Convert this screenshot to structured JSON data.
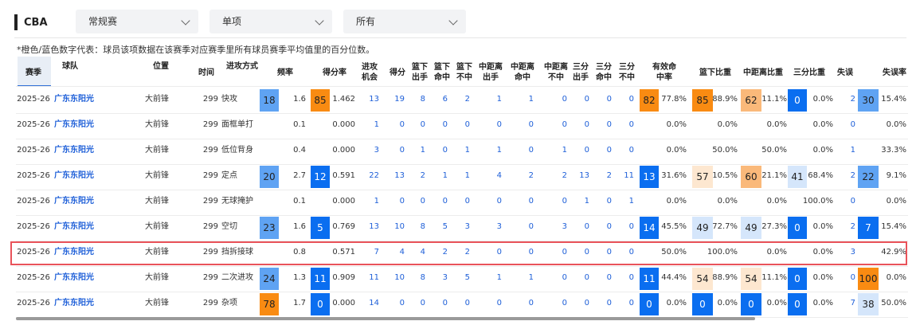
{
  "league": "CBA",
  "filters": [
    {
      "value": "常规赛"
    },
    {
      "value": "单项"
    },
    {
      "value": "所有"
    }
  ],
  "note": "*橙色/蓝色数字代表：球员该项数据在该赛季对应赛季里所有球员赛季平均值里的百分位数。",
  "columns": [
    "赛季",
    "球队",
    "位置",
    "时间",
    "进攻方式",
    "频率",
    "得分率",
    "进攻机会",
    "得分",
    "篮下出手",
    "篮下命中",
    "篮下不中",
    "中距离出手",
    "中距离命中",
    "中距离不中",
    "三分出手",
    "三分命中",
    "三分不中",
    "有效命中率",
    "篮下比重",
    "中距离比重",
    "三分比重",
    "失误",
    "失误率"
  ],
  "colors": {
    "orange_strong": "#f98b12",
    "orange_mid": "#fab97a",
    "orange_light": "#fde7d0",
    "blue_strong": "#0a6ef0",
    "blue_mid": "#5fa3f3",
    "blue_light": "#d5e6fb",
    "highlight": "#e9535a",
    "link": "#1e5fd8"
  },
  "rows": [
    {
      "season": "2025-26",
      "team": "广东东阳光",
      "pos": "大前锋",
      "time": "299",
      "play": "快攻",
      "freq_pct": "18",
      "freq": "1.6",
      "ppp_pct": "85",
      "ppp": "1.462",
      "poss": "13",
      "pts": "19",
      "rim_att": "8",
      "rim_made": "6",
      "rim_miss": "2",
      "mid_att": "1",
      "mid_made": "1",
      "mid_miss": "0",
      "three_att": "0",
      "three_made": "0",
      "three_miss": "0",
      "efg_pct": "82",
      "efg": "77.8%",
      "rim_share_pct": "85",
      "rim_share": "88.9%",
      "mid_share_pct": "62",
      "mid_share": "11.1%",
      "three_share_pct": "0",
      "three_share": "0.0%",
      "tov": "2",
      "tov_pct": "30",
      "tov_rate": "15.4%"
    },
    {
      "season": "2025-26",
      "team": "广东东阳光",
      "pos": "大前锋",
      "time": "299",
      "play": "面框单打",
      "freq_pct": "",
      "freq": "0.1",
      "ppp_pct": "",
      "ppp": "0.000",
      "poss": "1",
      "pts": "0",
      "rim_att": "0",
      "rim_made": "0",
      "rim_miss": "0",
      "mid_att": "0",
      "mid_made": "0",
      "mid_miss": "0",
      "three_att": "0",
      "three_made": "0",
      "three_miss": "0",
      "efg_pct": "",
      "efg": "0.0%",
      "rim_share_pct": "",
      "rim_share": "0.0%",
      "mid_share_pct": "",
      "mid_share": "0.0%",
      "three_share_pct": "",
      "three_share": "0.0%",
      "tov": "0",
      "tov_pct": "",
      "tov_rate": "0.0%"
    },
    {
      "season": "2025-26",
      "team": "广东东阳光",
      "pos": "大前锋",
      "time": "299",
      "play": "低位背身",
      "freq_pct": "",
      "freq": "0.4",
      "ppp_pct": "",
      "ppp": "0.000",
      "poss": "3",
      "pts": "0",
      "rim_att": "1",
      "rim_made": "0",
      "rim_miss": "1",
      "mid_att": "1",
      "mid_made": "0",
      "mid_miss": "1",
      "three_att": "0",
      "three_made": "0",
      "three_miss": "0",
      "efg_pct": "",
      "efg": "0.0%",
      "rim_share_pct": "",
      "rim_share": "50.0%",
      "mid_share_pct": "",
      "mid_share": "50.0%",
      "three_share_pct": "",
      "three_share": "0.0%",
      "tov": "1",
      "tov_pct": "",
      "tov_rate": "33.3%"
    },
    {
      "season": "2025-26",
      "team": "广东东阳光",
      "pos": "大前锋",
      "time": "299",
      "play": "定点",
      "freq_pct": "20",
      "freq": "2.7",
      "ppp_pct": "12",
      "ppp": "0.591",
      "poss": "22",
      "pts": "13",
      "rim_att": "2",
      "rim_made": "1",
      "rim_miss": "1",
      "mid_att": "4",
      "mid_made": "2",
      "mid_miss": "2",
      "three_att": "13",
      "three_made": "2",
      "three_miss": "11",
      "efg_pct": "13",
      "efg": "31.6%",
      "rim_share_pct": "57",
      "rim_share": "10.5%",
      "mid_share_pct": "60",
      "mid_share": "21.1%",
      "three_share_pct": "41",
      "three_share": "68.4%",
      "tov": "2",
      "tov_pct": "22",
      "tov_rate": "9.1%"
    },
    {
      "season": "2025-26",
      "team": "广东东阳光",
      "pos": "大前锋",
      "time": "299",
      "play": "无球掩护",
      "freq_pct": "",
      "freq": "0.1",
      "ppp_pct": "",
      "ppp": "0.000",
      "poss": "1",
      "pts": "0",
      "rim_att": "0",
      "rim_made": "0",
      "rim_miss": "0",
      "mid_att": "0",
      "mid_made": "0",
      "mid_miss": "0",
      "three_att": "1",
      "three_made": "0",
      "three_miss": "1",
      "efg_pct": "",
      "efg": "0.0%",
      "rim_share_pct": "",
      "rim_share": "0.0%",
      "mid_share_pct": "",
      "mid_share": "0.0%",
      "three_share_pct": "",
      "three_share": "100.0%",
      "tov": "0",
      "tov_pct": "",
      "tov_rate": "0.0%"
    },
    {
      "season": "2025-26",
      "team": "广东东阳光",
      "pos": "大前锋",
      "time": "299",
      "play": "空切",
      "freq_pct": "23",
      "freq": "1.6",
      "ppp_pct": "5",
      "ppp": "0.769",
      "poss": "13",
      "pts": "10",
      "rim_att": "8",
      "rim_made": "5",
      "rim_miss": "3",
      "mid_att": "3",
      "mid_made": "0",
      "mid_miss": "3",
      "three_att": "0",
      "three_made": "0",
      "three_miss": "0",
      "efg_pct": "14",
      "efg": "45.5%",
      "rim_share_pct": "49",
      "rim_share": "72.7%",
      "mid_share_pct": "49",
      "mid_share": "27.3%",
      "three_share_pct": "0",
      "three_share": "0.0%",
      "tov": "2",
      "tov_pct": "7",
      "tov_rate": "15.4%"
    },
    {
      "season": "2025-26",
      "team": "广东东阳光",
      "pos": "大前锋",
      "time": "299",
      "play": "挡拆接球",
      "freq_pct": "",
      "freq": "0.8",
      "ppp_pct": "",
      "ppp": "0.571",
      "poss": "7",
      "pts": "4",
      "rim_att": "4",
      "rim_made": "2",
      "rim_miss": "2",
      "mid_att": "0",
      "mid_made": "0",
      "mid_miss": "0",
      "three_att": "0",
      "three_made": "0",
      "three_miss": "0",
      "efg_pct": "",
      "efg": "50.0%",
      "rim_share_pct": "",
      "rim_share": "100.0%",
      "mid_share_pct": "",
      "mid_share": "0.0%",
      "three_share_pct": "",
      "three_share": "0.0%",
      "tov": "3",
      "tov_pct": "",
      "tov_rate": "42.9%"
    },
    {
      "season": "2025-26",
      "team": "广东东阳光",
      "pos": "大前锋",
      "time": "299",
      "play": "二次进攻",
      "freq_pct": "24",
      "freq": "1.3",
      "ppp_pct": "11",
      "ppp": "0.909",
      "poss": "11",
      "pts": "10",
      "rim_att": "8",
      "rim_made": "3",
      "rim_miss": "5",
      "mid_att": "1",
      "mid_made": "1",
      "mid_miss": "0",
      "three_att": "0",
      "three_made": "0",
      "three_miss": "0",
      "efg_pct": "11",
      "efg": "44.4%",
      "rim_share_pct": "54",
      "rim_share": "88.9%",
      "mid_share_pct": "54",
      "mid_share": "11.1%",
      "three_share_pct": "0",
      "three_share": "0.0%",
      "tov": "0",
      "tov_pct": "100",
      "tov_rate": "0.0%"
    },
    {
      "season": "2025-26",
      "team": "广东东阳光",
      "pos": "大前锋",
      "time": "299",
      "play": "杂项",
      "freq_pct": "78",
      "freq": "1.7",
      "ppp_pct": "0",
      "ppp": "0.000",
      "poss": "14",
      "pts": "0",
      "rim_att": "0",
      "rim_made": "0",
      "rim_miss": "0",
      "mid_att": "0",
      "mid_made": "0",
      "mid_miss": "0",
      "three_att": "0",
      "three_made": "0",
      "three_miss": "0",
      "efg_pct": "0",
      "efg": "0.0%",
      "rim_share_pct": "0",
      "rim_share": "0.0%",
      "mid_share_pct": "0",
      "mid_share": "0.0%",
      "three_share_pct": "0",
      "three_share": "0.0%",
      "tov": "7",
      "tov_pct": "38",
      "tov_rate": "50.0%"
    }
  ]
}
